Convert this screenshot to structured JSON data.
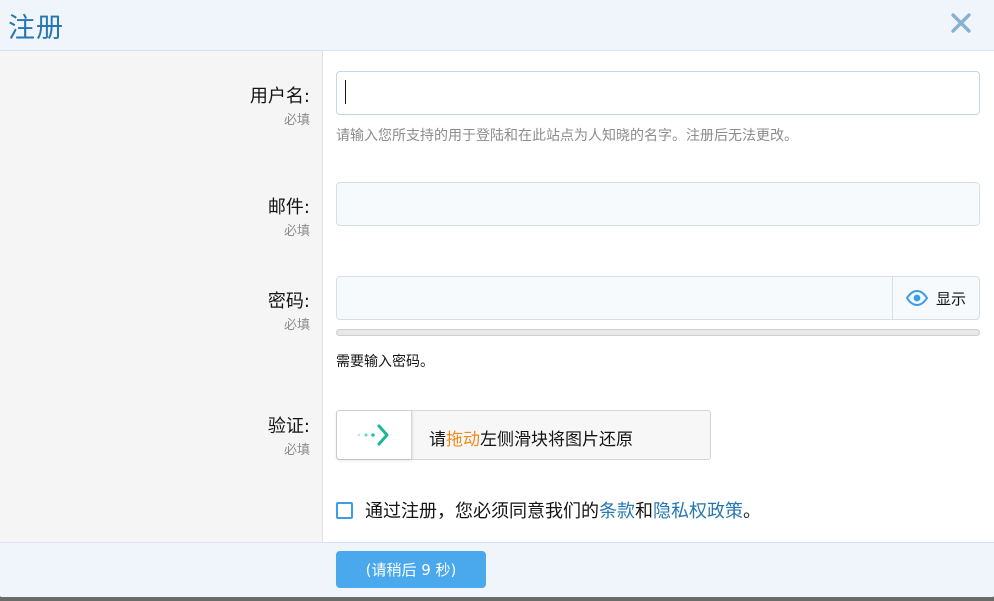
{
  "dialog": {
    "title": "注册",
    "close_icon": "close-icon"
  },
  "colors": {
    "accent": "#2577b1",
    "button": "#4aa8ec",
    "highlight": "#f08a1d"
  },
  "form": {
    "username": {
      "label": "用户名:",
      "required": "必填",
      "value": "",
      "hint": "请输入您所支持的用于登陆和在此站点为人知晓的名字。注册后无法更改。"
    },
    "email": {
      "label": "邮件:",
      "required": "必填",
      "value": ""
    },
    "password": {
      "label": "密码:",
      "required": "必填",
      "value": "",
      "show_label": "显示",
      "show_icon": "eye-icon",
      "hint": "需要输入密码。"
    },
    "verify": {
      "label": "验证:",
      "required": "必填",
      "slider_icon": "arrow-right-icon",
      "text_pre": "请",
      "text_highlight": "拖动",
      "text_post": "左侧滑块将图片还原"
    },
    "agreement": {
      "text_pre": "通过注册，您必须同意我们的",
      "terms_link": "条款",
      "and_text": "和",
      "privacy_link": "隐私权政策",
      "text_post": "。",
      "checked": false
    }
  },
  "footer": {
    "submit_label": "(请稍后 9 秒)"
  }
}
